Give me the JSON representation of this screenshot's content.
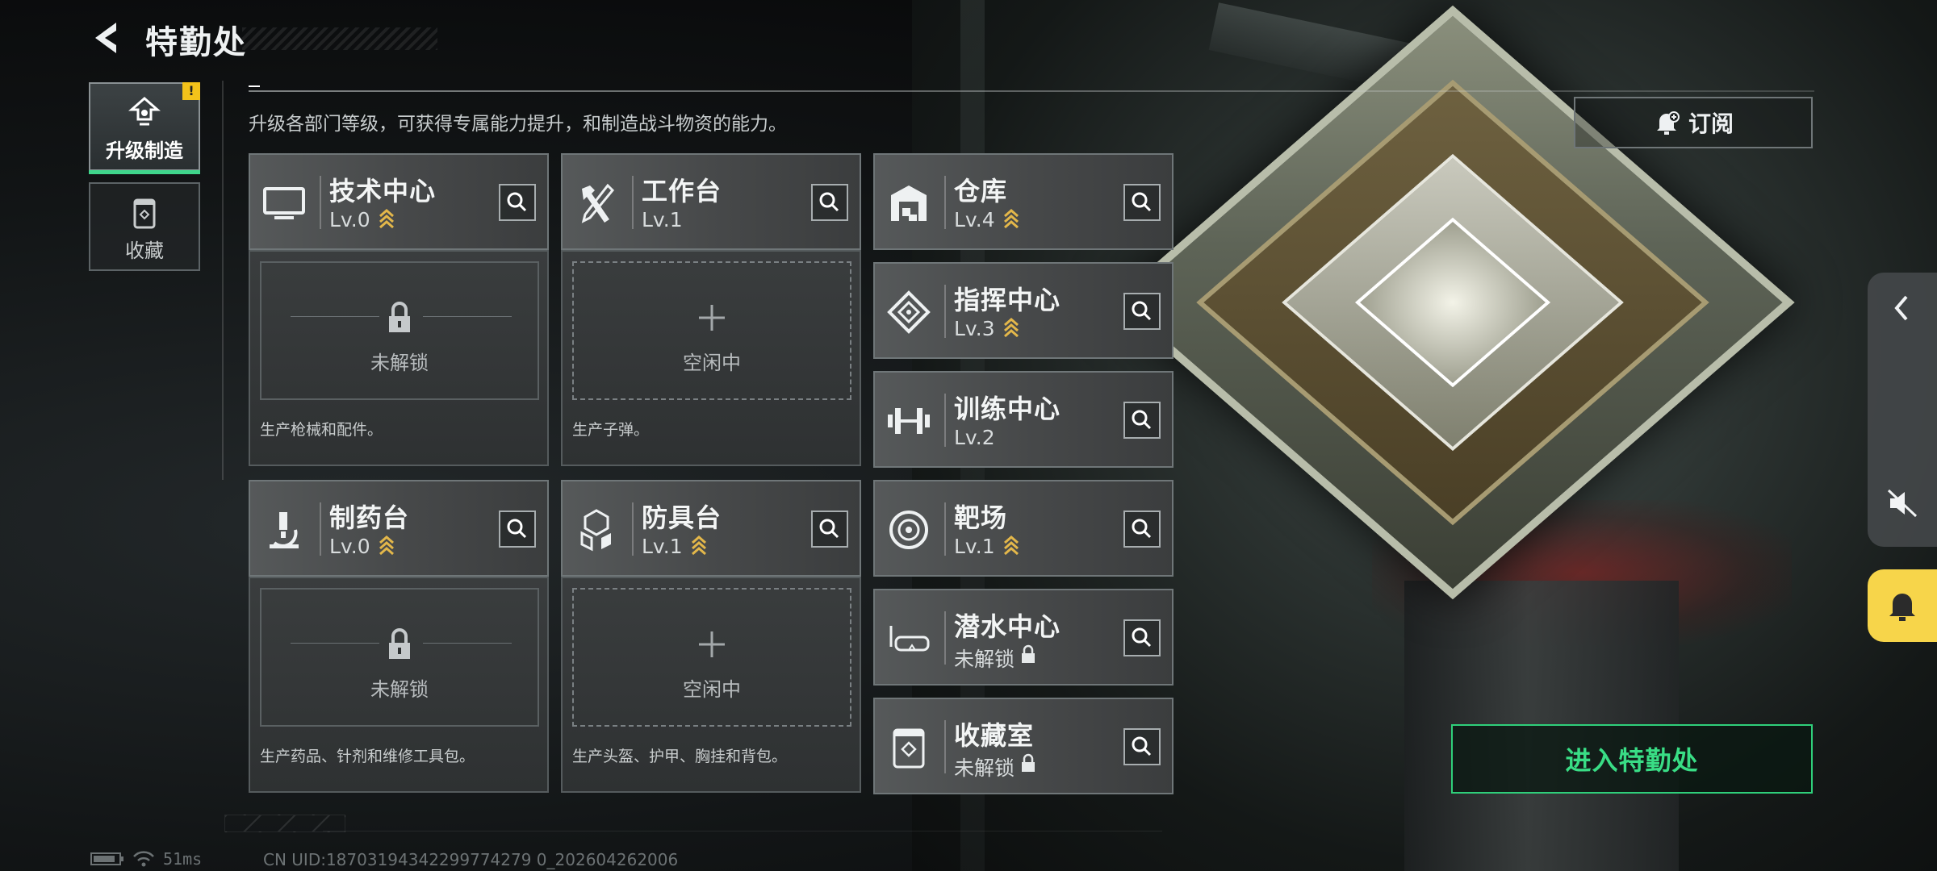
{
  "header": {
    "title": "特勤处"
  },
  "subtitle": "升级各部门等级，可获得专属能力提升，和制造战斗物资的能力。",
  "nav": {
    "badge": "!",
    "items": [
      {
        "label": "升级制造",
        "icon": "upgrade-icon",
        "active": true
      },
      {
        "label": "收藏",
        "icon": "collection-icon",
        "active": false
      }
    ]
  },
  "departments": [
    {
      "name": "技术中心",
      "level": "Lv.0",
      "status": "upgradable",
      "icon": "monitor-icon"
    },
    {
      "name": "工作台",
      "level": "Lv.1",
      "status": "none",
      "icon": "tools-icon"
    },
    {
      "name": "仓库",
      "level": "Lv.4",
      "status": "upgradable",
      "icon": "warehouse-icon"
    },
    {
      "name": "指挥中心",
      "level": "Lv.3",
      "status": "upgradable",
      "icon": "command-icon"
    },
    {
      "name": "训练中心",
      "level": "Lv.2",
      "status": "none",
      "icon": "dumbbell-icon"
    },
    {
      "name": "制药台",
      "level": "Lv.0",
      "status": "upgradable",
      "icon": "microscope-icon"
    },
    {
      "name": "防具台",
      "level": "Lv.1",
      "status": "upgradable",
      "icon": "armor-icon"
    },
    {
      "name": "靶场",
      "level": "Lv.1",
      "status": "upgradable",
      "icon": "target-icon"
    },
    {
      "name": "潜水中心",
      "level": "未解锁",
      "status": "locked",
      "icon": "diving-mask-icon"
    },
    {
      "name": "收藏室",
      "level": "未解锁",
      "status": "locked",
      "icon": "collection-room-icon"
    }
  ],
  "production": [
    {
      "state_label": "未解锁",
      "description": "生产枪械和配件。",
      "state": "locked"
    },
    {
      "state_label": "空闲中",
      "description": "生产子弹。",
      "state": "idle"
    },
    {
      "state_label": "未解锁",
      "description": "生产药品、针剂和维修工具包。",
      "state": "locked"
    },
    {
      "state_label": "空闲中",
      "description": "生产头盔、护甲、胸挂和背包。",
      "state": "idle"
    }
  ],
  "subscribe": {
    "label": "订阅",
    "icon": "bell-plus-icon"
  },
  "enter_button": {
    "label": "进入特勤处"
  },
  "status": {
    "ping": "51ms",
    "uid": "CN UID:18703194342299774279 0_202604262006"
  },
  "colors": {
    "accent_green": "#39dd85",
    "badge_yellow": "#f3c21a",
    "upgrade_gold": "#e3b74a",
    "bell_yellow": "#f7d54a"
  }
}
